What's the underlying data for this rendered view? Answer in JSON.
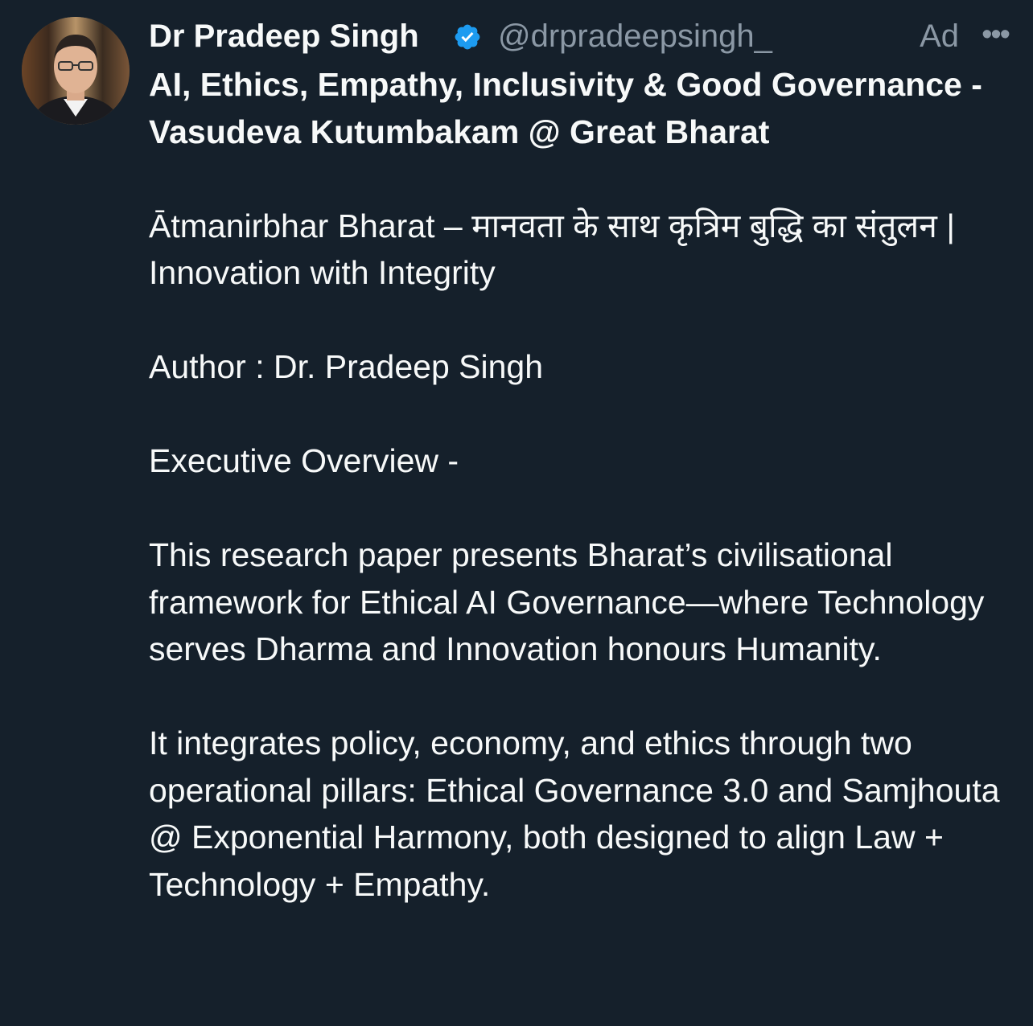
{
  "post": {
    "author_name": "Dr Pradeep Singh",
    "handle": "@drpradeepsingh_",
    "ad_label": "Ad",
    "more_label": "•••",
    "title": "AI, Ethics, Empathy, Inclusivity & Good Governance - Vasudeva Kutumbakam @ Great Bharat",
    "paragraphs": [
      "Ātmanirbhar Bharat – मानवता के साथ कृत्रिम बुद्धि का संतुलन | Innovation with Integrity",
      "Author : Dr. Pradeep Singh",
      "Executive Overview -",
      "This research paper presents Bharat’s civilisational framework for Ethical AI Governance—where Technology serves Dharma and Innovation honours Humanity.",
      "It integrates policy, economy, and ethics through two operational pillars: Ethical Governance 3.0 and Samjhouta @ Exponential Harmony, both designed to align Law + Technology + Empathy."
    ]
  },
  "colors": {
    "background": "#15202b",
    "text": "#f7f9f9",
    "muted": "#8b98a5",
    "verified": "#1d9bf0"
  },
  "icons": {
    "verified": "verified-badge-icon",
    "more": "more-horizontal-icon"
  }
}
